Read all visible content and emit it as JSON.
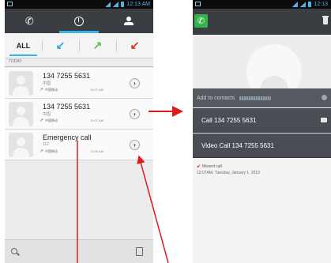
{
  "left_phone": {
    "status_time": "12:13 AM",
    "filters": [
      {
        "label": "ALL"
      },
      {
        "icon": "incoming-call-arrow"
      },
      {
        "icon": "outgoing-call-arrow"
      },
      {
        "icon": "missed-call-arrow"
      }
    ],
    "section_header": "TODAY",
    "calls": [
      {
        "name": "134 7255 5631",
        "location": "中国",
        "carrier": "中国移动",
        "time": "12:07 AM",
        "type": "outgoing"
      },
      {
        "name": "134 7255 5631",
        "location": "中国",
        "carrier": "中国移动",
        "time": "12:07 AM",
        "type": "outgoing"
      },
      {
        "name": "Emergency call",
        "location": "112",
        "carrier": "中国移动",
        "time": "12:06 AM",
        "type": "outgoing"
      }
    ],
    "detail_glyph": "›"
  },
  "right_phone": {
    "status_time": "12:13",
    "add_to_contacts": "Add to contacts",
    "call_label": "Call 134 7255 5631",
    "video_call_label": "Video Call 134 7255 5631",
    "call_type": "Missed call",
    "call_datetime": "12:07AM, Tuesday, January 1, 2013"
  },
  "colors": {
    "accent": "#33b5e5",
    "incoming": "#3aa3e0",
    "outgoing": "#5cc34c",
    "missed": "#d6332a",
    "annotation": "#e01b1b"
  }
}
